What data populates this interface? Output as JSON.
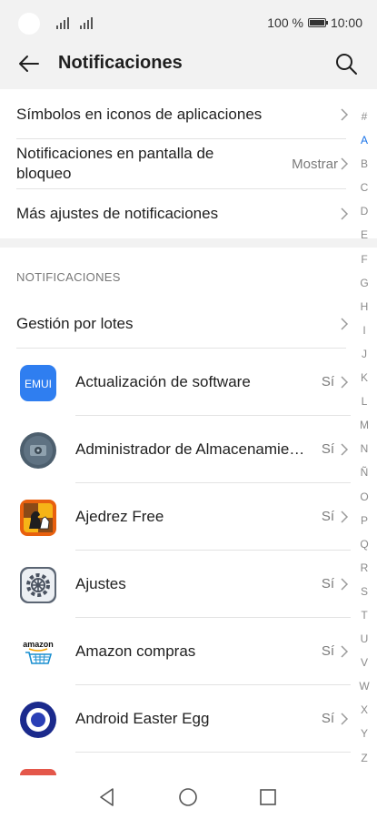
{
  "status_bar": {
    "battery": "100 %",
    "time": "10:00"
  },
  "header": {
    "title": "Notificaciones",
    "back_icon": "arrow-left",
    "search_icon": "magnifier"
  },
  "settings": [
    {
      "label": "Símbolos en iconos de aplicaciones",
      "value": ""
    },
    {
      "label": "Notificaciones en pantalla de bloqueo",
      "value": "Mostrar"
    },
    {
      "label": "Más ajustes de notificaciones",
      "value": ""
    }
  ],
  "section_header": "NOTIFICACIONES",
  "batch": {
    "label": "Gestión por lotes"
  },
  "apps": [
    {
      "name": "Actualización de software",
      "status": "Sí",
      "icon": "emui",
      "icon_text": "EMUI"
    },
    {
      "name": "Administrador de Almacenamiento",
      "status": "Sí",
      "icon": "storage-manager"
    },
    {
      "name": "Ajedrez Free",
      "status": "Sí",
      "icon": "chess"
    },
    {
      "name": "Ajustes",
      "status": "Sí",
      "icon": "gear"
    },
    {
      "name": "Amazon compras",
      "status": "Sí",
      "icon": "amazon-cart",
      "icon_text": "amazon"
    },
    {
      "name": "Android Easter Egg",
      "status": "Sí",
      "icon": "easter-egg-ring"
    }
  ],
  "alphabet": [
    "#",
    "A",
    "B",
    "C",
    "D",
    "E",
    "F",
    "G",
    "H",
    "I",
    "J",
    "K",
    "L",
    "M",
    "N",
    "Ñ",
    "O",
    "P",
    "Q",
    "R",
    "S",
    "T",
    "U",
    "V",
    "W",
    "X",
    "Y",
    "Z"
  ],
  "alphabet_active": "A",
  "nav": {
    "back_icon": "triangle-back",
    "home_icon": "circle-home",
    "recent_icon": "square-recent"
  },
  "colors": {
    "accent": "#1a73e8",
    "header_bg": "#f2f2f2",
    "emui_blue": "#2f7ef0",
    "easter_egg": "#1b2a8c"
  }
}
